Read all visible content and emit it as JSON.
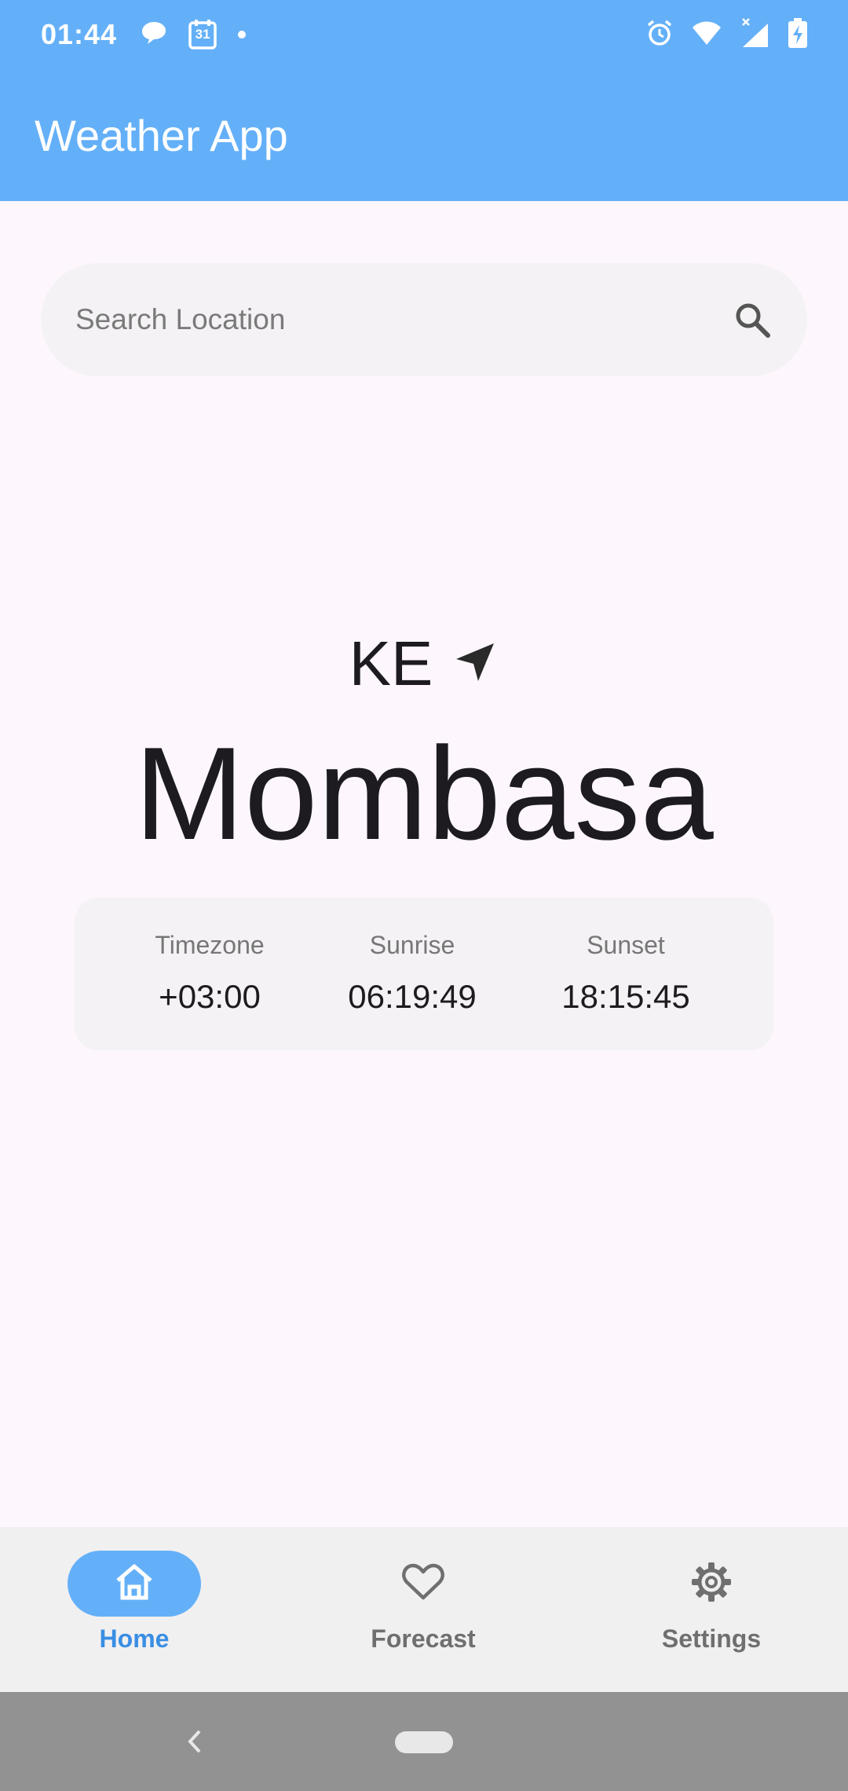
{
  "status_bar": {
    "time": "01:44",
    "calendar_day": "31",
    "left_icons": [
      "chat-bubble-icon",
      "calendar-icon",
      "dot-icon"
    ],
    "right_icons": [
      "alarm-icon",
      "wifi-icon",
      "cell-signal-icon",
      "battery-charging-icon"
    ]
  },
  "app_bar": {
    "title": "Weather App",
    "color": "#64b0f8"
  },
  "search": {
    "placeholder": "Search Location",
    "value": "",
    "icon": "search-icon"
  },
  "location": {
    "country_code": "KE",
    "city": "Mombasa",
    "direction_icon": "navigation-arrow-icon"
  },
  "info": {
    "timezone": {
      "label": "Timezone",
      "value": "+03:00"
    },
    "sunrise": {
      "label": "Sunrise",
      "value": "06:19:49"
    },
    "sunset": {
      "label": "Sunset",
      "value": "18:15:45"
    }
  },
  "bottom_nav": {
    "accent": "#3a8ee3",
    "items": [
      {
        "label": "Home",
        "icon": "home-icon",
        "active": true
      },
      {
        "label": "Forecast",
        "icon": "heart-icon",
        "active": false
      },
      {
        "label": "Settings",
        "icon": "gear-icon",
        "active": false
      }
    ]
  },
  "system_nav": {
    "buttons": [
      "back-icon",
      "home-pill-icon"
    ]
  }
}
